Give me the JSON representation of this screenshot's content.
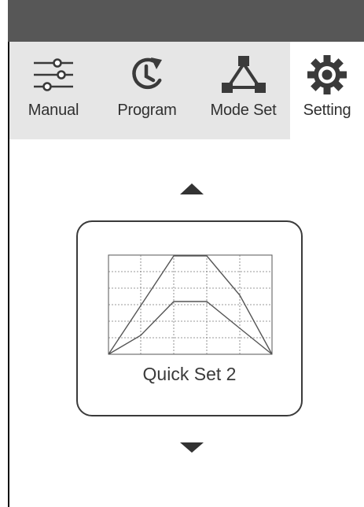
{
  "tabs": [
    {
      "label": "Manual",
      "icon": "sliders-icon"
    },
    {
      "label": "Program",
      "icon": "clock-refresh-icon"
    },
    {
      "label": "Mode Set",
      "icon": "triangle-nodes-icon"
    },
    {
      "label": "Setting",
      "icon": "gear-icon"
    }
  ],
  "active_tab": "Setting",
  "preset": {
    "name": "Quick Set 2",
    "graph_icon": "speed-profile-graph-icon"
  },
  "controls": {
    "up_icon": "arrow-up-icon",
    "down_icon": "arrow-down-icon"
  },
  "colors": {
    "header": "#575757",
    "tab_background": "#e6e6e6",
    "active_tab_background": "#ffffff",
    "icon": "#3a3a3a"
  }
}
